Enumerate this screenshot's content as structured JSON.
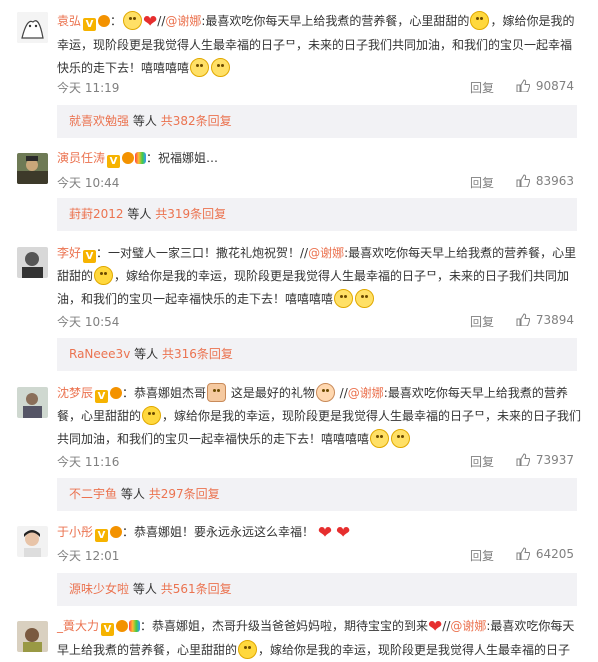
{
  "comments": [
    {
      "user": "袁弘",
      "text_parts": [
        "//",
        "@谢娜",
        ":最喜欢吃你每天早上给我煮的营养餐，心里甜甜的",
        "，嫁给你是我的幸运，现阶段更是我觉得人生最幸福的日子ᄆ，未来的日子我们共同加油，和我们的宝贝一起幸福快乐的走下去！嘻嘻嘻嘻"
      ],
      "time": "今天 11:19",
      "reply": "回复",
      "likes": "90874",
      "reply_user": "就喜欢勉强",
      "reply_mid": "等人",
      "reply_count": "共382条回复"
    },
    {
      "user": "演员任涛",
      "text_parts": [
        "：祝福娜姐…"
      ],
      "time": "今天 10:44",
      "reply": "回复",
      "likes": "83963",
      "reply_user": "葑葑2012",
      "reply_mid": "等人",
      "reply_count": "共319条回复"
    },
    {
      "user": "李好",
      "text_parts": [
        "：一对璧人一家三口！撒花礼炮祝贺！//",
        "@谢娜",
        ":最喜欢吃你每天早上给我煮的营养餐，心里甜甜的",
        "，嫁给你是我的幸运，现阶段更是我觉得人生最幸福的日子ᄆ，未来的日子我们共同加油，和我们的宝贝一起幸福快乐的走下去！嘻嘻嘻嘻"
      ],
      "time": "今天 10:54",
      "reply": "回复",
      "likes": "73894",
      "reply_user": "RaNeee3v",
      "reply_mid": "等人",
      "reply_count": "共316条回复"
    },
    {
      "user": "沈梦辰",
      "text_parts": [
        "：恭喜娜姐杰哥",
        " 这是最好的礼物",
        " //",
        "@谢娜",
        ":最喜欢吃你每天早上给我煮的营养餐，心里甜甜的",
        "，嫁给你是我的幸运，现阶段更是我觉得人生最幸福的日子ᄆ，未来的日子我们共同加油，和我们的宝贝一起幸福快乐的走下去！嘻嘻嘻嘻"
      ],
      "time": "今天 11:16",
      "reply": "回复",
      "likes": "73937",
      "reply_user": "不二宇鱼",
      "reply_mid": "等人",
      "reply_count": "共297条回复"
    },
    {
      "user": "于小彤",
      "text_parts": [
        "：恭喜娜姐！要永远永远这么幸福！"
      ],
      "time": "今天 12:01",
      "reply": "回复",
      "likes": "64205",
      "reply_user": "源味少女啦",
      "reply_mid": "等人",
      "reply_count": "共561条回复"
    },
    {
      "user": "_蕢大力",
      "text_parts": [
        "：恭喜娜姐，杰哥升级当爸爸妈妈啦，期待宝宝的到来",
        "//",
        "@谢娜",
        ":最喜欢吃你每天早上给我煮的营养餐，心里甜甜的",
        "，嫁给你是我的幸运，现阶段更是我觉得人生最幸福的日子"
      ]
    }
  ]
}
